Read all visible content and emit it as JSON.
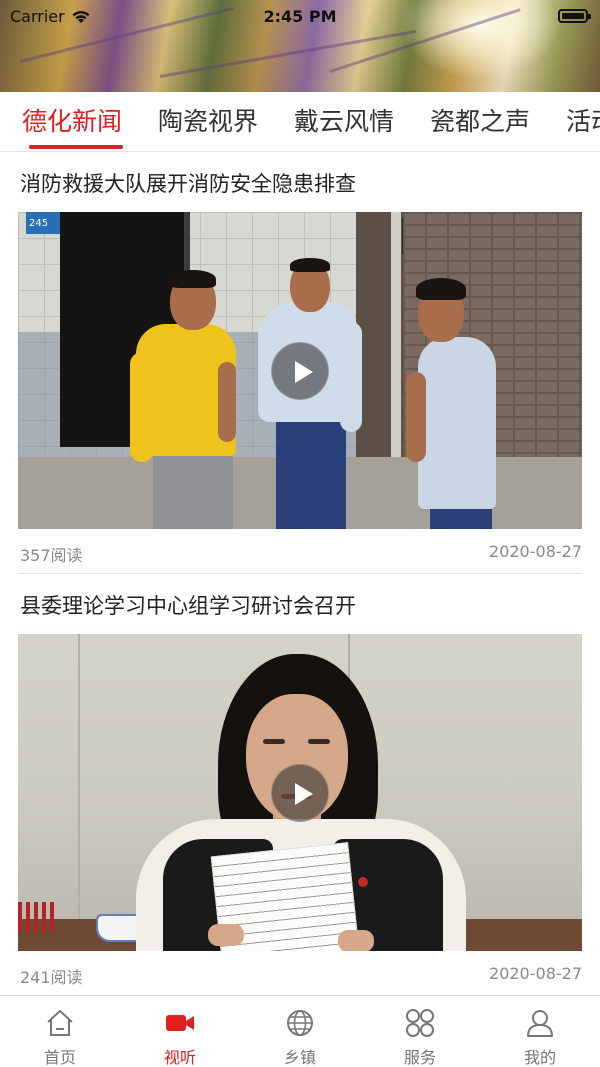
{
  "status_bar": {
    "carrier": "Carrier",
    "time": "2:45 PM"
  },
  "tabs": [
    {
      "label": "德化新闻",
      "active": true
    },
    {
      "label": "陶瓷视界",
      "active": false
    },
    {
      "label": "戴云风情",
      "active": false
    },
    {
      "label": "瓷都之声",
      "active": false
    },
    {
      "label": "活动",
      "active": false
    }
  ],
  "articles": [
    {
      "title": "消防救援大队展开消防安全隐患排查",
      "reads": "357阅读",
      "date": "2020-08-27",
      "sign_text": "245"
    },
    {
      "title": "县委理论学习中心组学习研讨会召开",
      "reads": "241阅读",
      "date": "2020-08-27"
    }
  ],
  "bottom_nav": [
    {
      "label": "首页",
      "icon": "home-icon",
      "active": false
    },
    {
      "label": "视听",
      "icon": "video-camera-icon",
      "active": true
    },
    {
      "label": "乡镇",
      "icon": "globe-icon",
      "active": false
    },
    {
      "label": "服务",
      "icon": "grid-four-circles-icon",
      "active": false
    },
    {
      "label": "我的",
      "icon": "user-icon",
      "active": false
    }
  ],
  "colors": {
    "accent": "#e02020",
    "inactive_text": "#777777"
  }
}
